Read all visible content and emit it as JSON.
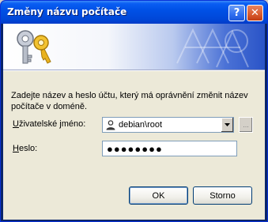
{
  "window": {
    "title": "Změny názvu počítače",
    "help_label": "?",
    "close_label": "✕"
  },
  "prompt": "Zadejte název a heslo účtu, který má oprávnění změnit název počítače v doméně.",
  "username": {
    "label_accel": "U",
    "label_rest": "živatelské jméno:",
    "value": "debian\\root",
    "icon": "user-icon"
  },
  "browse": {
    "label": "..."
  },
  "password": {
    "label_accel": "H",
    "label_rest": "eslo:",
    "value": "●●●●●●●●"
  },
  "buttons": {
    "ok_label": "OK",
    "cancel_label": "Storno"
  },
  "colors": {
    "titlebar": "#0051e6",
    "client": "#ece9d8",
    "close_button": "#d85a2e"
  }
}
